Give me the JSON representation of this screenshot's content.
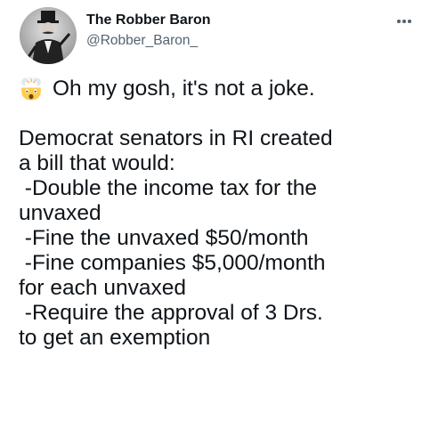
{
  "tweet": {
    "author": {
      "display_name": "The Robber Baron",
      "handle": "@Robber_Baron_"
    },
    "more_icon": "more-horizontal-icon",
    "emoji_icon": "exploding-head-emoji",
    "lines": [
      "Oh my gosh, it's not a joke.",
      "",
      "Democrat senators in RI created",
      "a bill that would:",
      " -Double the income tax for the",
      "unvaxed",
      " -Fine the unvaxed $50/month",
      " -Fine companies $5,000/month",
      "for each unvaxed",
      " -Require the approval of 3 Drs.",
      "to get an exemption"
    ]
  },
  "colors": {
    "text": "#0f1419",
    "secondary_text": "#536471",
    "background": "#ffffff"
  }
}
